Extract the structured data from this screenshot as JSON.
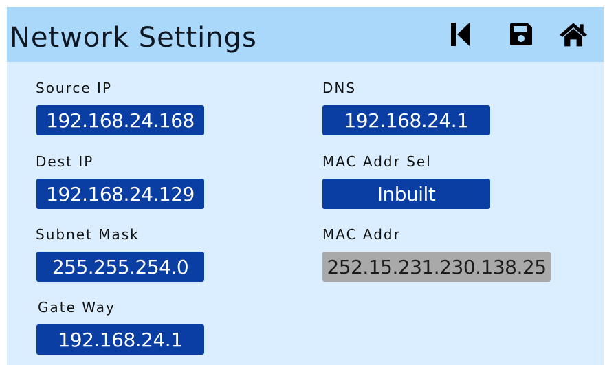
{
  "header": {
    "title": "Network Settings",
    "icons": [
      "skip-back-icon",
      "save-icon",
      "home-icon"
    ]
  },
  "fields": {
    "source_ip": {
      "label": "Source IP",
      "value": "192.168.24.168"
    },
    "dest_ip": {
      "label": "Dest IP",
      "value": "192.168.24.129"
    },
    "subnet_mask": {
      "label": "Subnet Mask",
      "value": "255.255.254.0"
    },
    "gateway": {
      "label": "Gate Way",
      "value": "192.168.24.1"
    },
    "dns": {
      "label": "DNS",
      "value": "192.168.24.1"
    },
    "mac_addr_sel": {
      "label": "MAC Addr Sel",
      "value": "Inbuilt"
    },
    "mac_addr": {
      "label": "MAC Addr",
      "value": "252.15.231.230.138.25"
    }
  },
  "colors": {
    "header_bg": "#aad8fb",
    "panel_bg": "#dbeeff",
    "field_bg": "#0a3ea3",
    "readonly_bg": "#a9a9a9"
  }
}
